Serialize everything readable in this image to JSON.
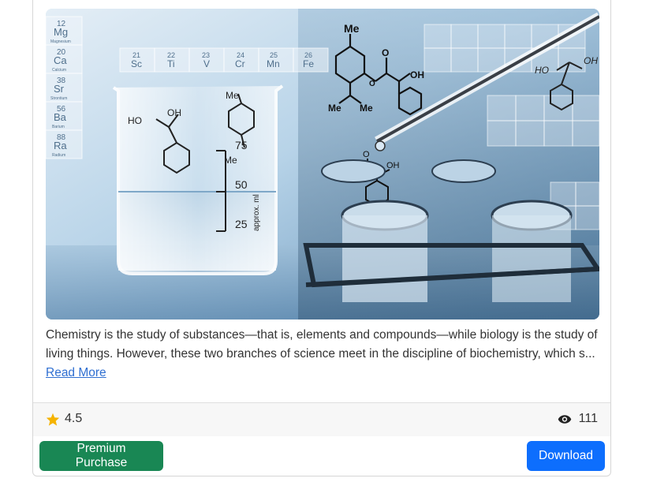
{
  "card": {
    "image_alt": "Chemistry lab glassware with molecular structures and periodic table",
    "image_labels": {
      "mg_num": "12",
      "mg": "Mg",
      "mg_name": "Magnesium",
      "ca_num": "20",
      "ca": "Ca",
      "ca_name": "Calcium",
      "sr_num": "38",
      "sr": "Sr",
      "sr_name": "Strontium",
      "ba_num": "56",
      "ba": "Ba",
      "ba_name": "Barium",
      "ra_num": "88",
      "ra": "Ra",
      "ra_name": "Radium",
      "sc_num": "21",
      "sc": "Sc",
      "ti_num": "22",
      "ti": "Ti",
      "v_num": "23",
      "v": "V",
      "cr_num": "24",
      "cr": "Cr",
      "mn_num": "25",
      "mn": "Mn",
      "fe_num": "26",
      "fe": "Fe",
      "beaker_75": "75",
      "beaker_50": "50",
      "beaker_25": "25",
      "approx": "approx. ml",
      "me1": "Me",
      "me2": "Me",
      "me3": "Me",
      "me4": "Me",
      "oh1": "OH",
      "oh2": "OH",
      "oh3": "OH",
      "oh4": "OH",
      "ho1": "HO",
      "ho2": "HO",
      "ho3": "HO",
      "o1": "O",
      "o2": "O",
      "o3": "O"
    },
    "description": "Chemistry is the study of substances—that is, elements and compounds—while biology is the study of living things. However, these two branches of science meet in the discipline of biochemistry, which s...",
    "read_more": "Read More",
    "rating": "4.5",
    "views": "111",
    "premium_label": "Premium Purchase",
    "download_label": "Download",
    "colors": {
      "premium": "#198754",
      "download": "#0d6efd",
      "star": "#f5b301",
      "link": "#2f6fd1"
    },
    "icons": {
      "rating": "star-icon",
      "views": "eye-icon"
    }
  }
}
